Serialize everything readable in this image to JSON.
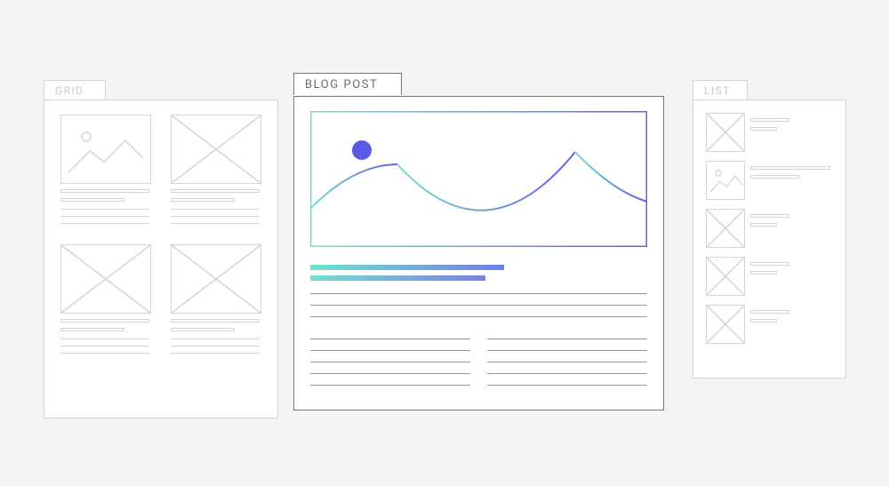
{
  "tabs": {
    "grid": "GRID",
    "blog": "BLOG POST",
    "list": "LIST"
  },
  "colors": {
    "fadedStroke": "#d5d5d5",
    "mainStroke": "#777777",
    "gradientStart": "#6fe3cf",
    "gradientEnd": "#6a5de0",
    "dot": "#5a5ae6"
  }
}
